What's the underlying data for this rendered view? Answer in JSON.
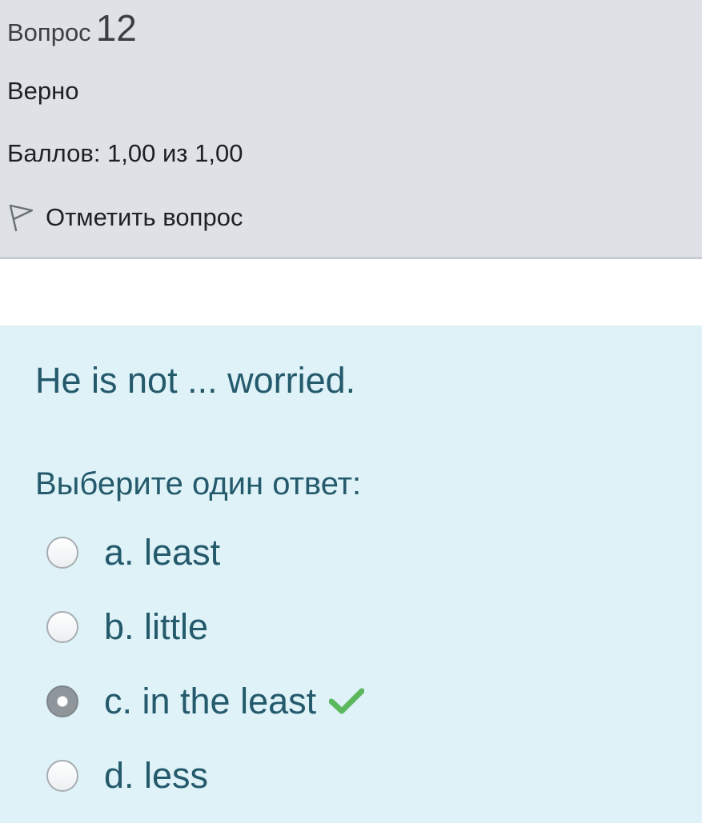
{
  "info": {
    "question_label": "Вопрос",
    "question_number": "12",
    "state": "Верно",
    "grade": "Баллов: 1,00 из 1,00",
    "flag_label": "Отметить вопрос",
    "flag_icon": "flag-outline-icon"
  },
  "question": {
    "text": "He is not ... worried.",
    "prompt": "Выберите один ответ:",
    "answers": [
      {
        "label": "a. least",
        "selected": false
      },
      {
        "label": "b. little",
        "selected": false
      },
      {
        "label": "c. in the least",
        "selected": true,
        "correct": true
      },
      {
        "label": "d. less",
        "selected": false
      }
    ],
    "correct_icon": "check-icon"
  },
  "colors": {
    "info_bg": "#dee2e6",
    "question_bg": "#def2f8",
    "question_text": "#245a6b",
    "correct_check": "#5cb85c"
  }
}
